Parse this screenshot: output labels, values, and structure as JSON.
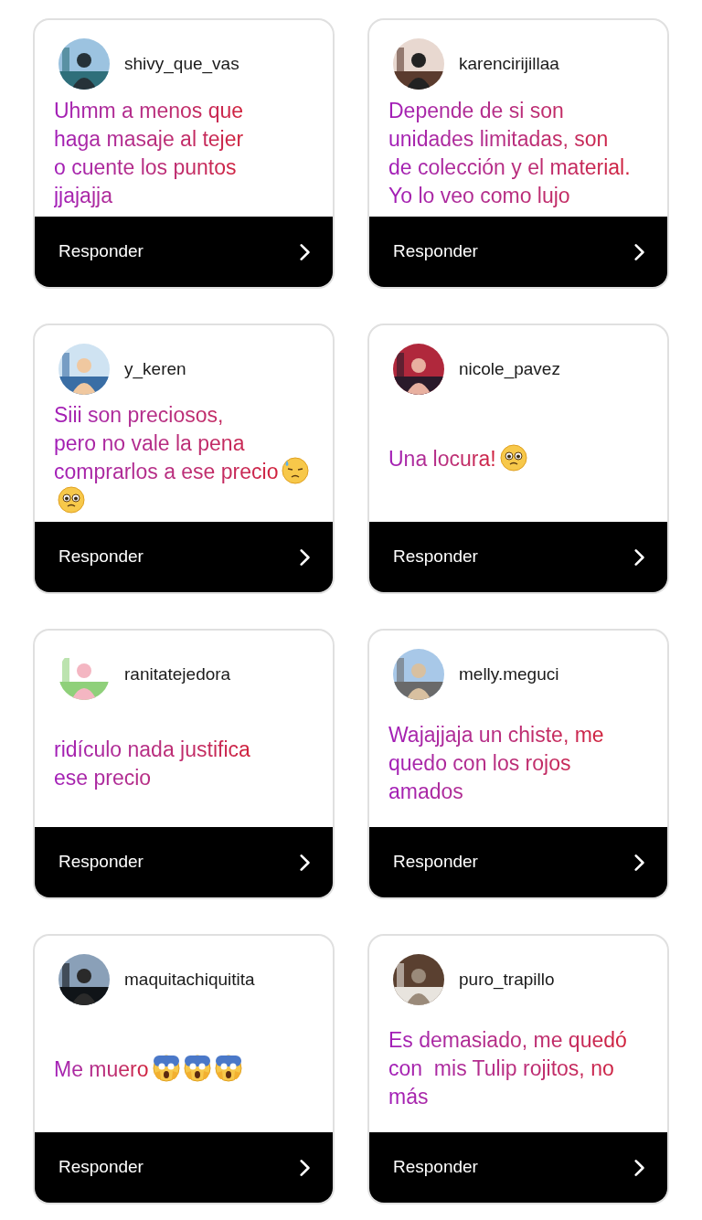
{
  "comments": [
    {
      "username": "shivy_que_vas",
      "text": "Uhmm a menos que\nhaga masaje al tejer\no cuente los puntos\njjajajja",
      "reply": "Responder"
    },
    {
      "username": "karencirijillaa",
      "text": "Depende de si son\nunidades limitadas, son\nde colección y el material.\nYo lo veo como lujo",
      "reply": "Responder"
    },
    {
      "username": "y_keren",
      "text": "Siii son preciosos,\npero no vale la pena\ncomprarlos a ese precio",
      "emojis": [
        {
          "kind": "sweat"
        },
        {
          "kind": "pleading"
        }
      ],
      "reply": "Responder"
    },
    {
      "username": "nicole_pavez",
      "text": "Una locura!",
      "emojis": [
        {
          "kind": "pleading"
        }
      ],
      "reply": "Responder"
    },
    {
      "username": "ranitatejedora",
      "text": "ridículo nada justifica\nese precio",
      "reply": "Responder"
    },
    {
      "username": "melly.meguci",
      "text": "Wajajjaja un chiste, me\nquedo con los rojos\namados",
      "reply": "Responder"
    },
    {
      "username": "maquitachiquitita",
      "text": "Me muero",
      "emojis": [
        {
          "kind": "scream"
        },
        {
          "kind": "scream"
        },
        {
          "kind": "scream"
        }
      ],
      "reply": "Responder"
    },
    {
      "username": "puro_trapillo",
      "text": "Es demasiado, me quedó\ncon  mis Tulip rojitos, no\nmás",
      "reply": "Responder"
    }
  ]
}
